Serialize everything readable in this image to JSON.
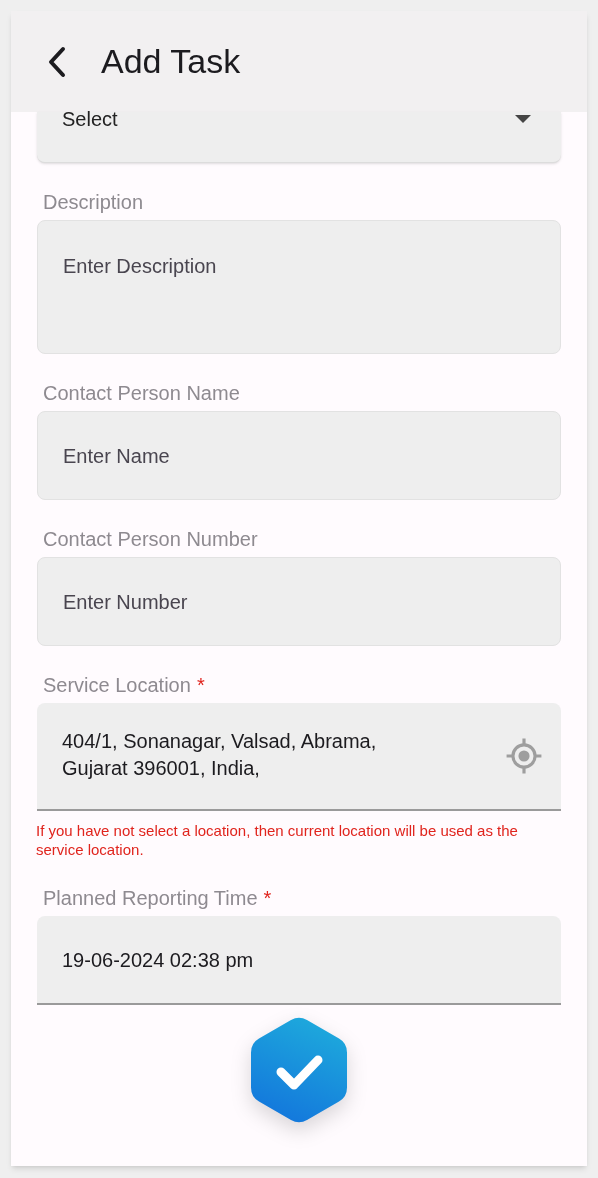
{
  "header": {
    "title": "Add Task"
  },
  "fields": [
    {
      "kind": "select",
      "value": "Select"
    },
    {
      "kind": "textarea",
      "label": "Description",
      "placeholder": "Enter Description"
    },
    {
      "kind": "text",
      "label": "Contact Person Name",
      "placeholder": "Enter Name"
    },
    {
      "kind": "text",
      "label": "Contact Person Number",
      "placeholder": "Enter Number"
    },
    {
      "kind": "location",
      "label": "Service Location",
      "required_mark": "*",
      "value": "404/1, Sonanagar, Valsad, Abrama, Gujarat 396001, India,",
      "helper": "If you have not select a location, then current location will be used as the service location."
    },
    {
      "kind": "datetime",
      "label": "Planned Reporting Time",
      "required_mark": "*",
      "value": "19-06-2024 02:38 pm"
    }
  ]
}
